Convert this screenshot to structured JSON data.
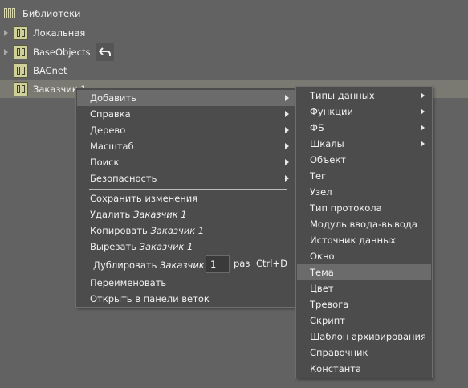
{
  "tree": {
    "root": {
      "label": "Библиотеки"
    },
    "items": [
      {
        "label": "Локальная",
        "badge": ""
      },
      {
        "label": "BaseObjects",
        "badge": ""
      },
      {
        "label": "BACnet",
        "badge": ""
      },
      {
        "label": "Заказчик 1",
        "badge": ""
      }
    ]
  },
  "context_menu": {
    "items": [
      {
        "label": "Добавить"
      },
      {
        "label": "Справка"
      },
      {
        "label": "Дерево"
      },
      {
        "label": "Масштаб"
      },
      {
        "label": "Поиск"
      },
      {
        "label": "Безопасность"
      }
    ],
    "save": "Сохранить изменения",
    "delete": {
      "prefix": "Удалить ",
      "target": "Заказчик 1"
    },
    "copy": {
      "prefix": "Копировать ",
      "target": "Заказчик 1"
    },
    "cut": {
      "prefix": "Вырезать ",
      "target": "Заказчик 1"
    },
    "duplicate": {
      "prefix": "Дублировать ",
      "target": "Заказчик 1",
      "count": "1",
      "unit": "раз",
      "shortcut": "Ctrl+D"
    },
    "rename": "Переименовать",
    "open_branch": "Открыть в панели веток"
  },
  "add_submenu": {
    "items": [
      {
        "label": "Типы данных"
      },
      {
        "label": "Функции"
      },
      {
        "label": "ФБ"
      },
      {
        "label": "Шкалы"
      },
      {
        "label": "Объект"
      },
      {
        "label": "Тег"
      },
      {
        "label": "Узел"
      },
      {
        "label": "Тип протокола"
      },
      {
        "label": "Модуль ввода-вывода"
      },
      {
        "label": "Источник данных"
      },
      {
        "label": "Окно"
      },
      {
        "label": "Тема"
      },
      {
        "label": "Цвет"
      },
      {
        "label": "Тревога"
      },
      {
        "label": "Скрипт"
      },
      {
        "label": "Шаблон архивирования"
      },
      {
        "label": "Справочник"
      },
      {
        "label": "Константа"
      }
    ]
  }
}
